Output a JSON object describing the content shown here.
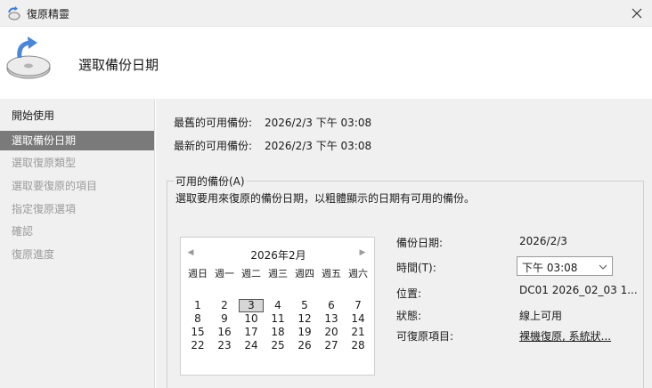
{
  "window": {
    "title": "復原精靈"
  },
  "header": {
    "heading": "選取備份日期"
  },
  "sidebar": {
    "steps": [
      {
        "label": "開始使用"
      },
      {
        "label": "選取備份日期"
      },
      {
        "label": "選取復原類型"
      },
      {
        "label": "選取要復原的項目"
      },
      {
        "label": "指定復原選項"
      },
      {
        "label": "確認"
      },
      {
        "label": "復原進度"
      }
    ]
  },
  "info": {
    "oldest_label": "最舊的可用備份:",
    "oldest_value": "2026/2/3 下午 03:08",
    "newest_label": "最新的可用備份:",
    "newest_value": "2026/2/3 下午 03:08"
  },
  "group": {
    "title": "可用的備份(A)",
    "description": "選取要用來復原的備份日期，以粗體顯示的日期有可用的備份。"
  },
  "calendar": {
    "month": "2026年2月",
    "weekdays": [
      "週日",
      "週一",
      "週二",
      "週三",
      "週四",
      "週五",
      "週六"
    ],
    "weeks": [
      [
        "1",
        "2",
        "3",
        "4",
        "5",
        "6",
        "7"
      ],
      [
        "8",
        "9",
        "10",
        "11",
        "12",
        "13",
        "14"
      ],
      [
        "15",
        "16",
        "17",
        "18",
        "19",
        "20",
        "21"
      ],
      [
        "22",
        "23",
        "24",
        "25",
        "26",
        "27",
        "28"
      ]
    ],
    "selected": "3"
  },
  "details": {
    "date_label": "備份日期:",
    "date_value": "2026/2/3",
    "time_label": "時間(T):",
    "time_value": "下午 03:08",
    "location_label": "位置:",
    "location_value": "DC01 2026_02_03 1...",
    "status_label": "狀態:",
    "status_value": "線上可用",
    "items_label": "可復原項目:",
    "items_value": "裸機復原, 系統狀..."
  }
}
